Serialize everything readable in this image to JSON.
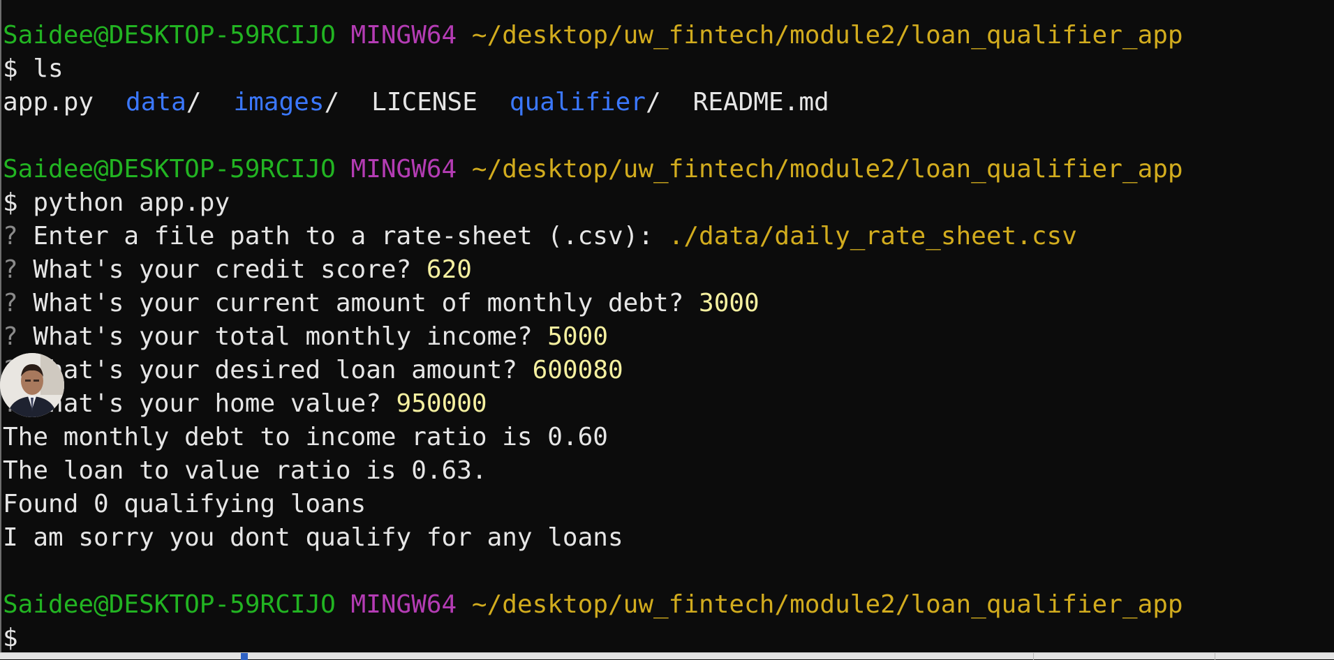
{
  "prompt": {
    "user_host": "Saidee@DESKTOP-59RCIJO",
    "env": "MINGW64",
    "path": "~/desktop/uw_fintech/module2/loan_qualifier_app",
    "symbol": "$"
  },
  "commands": {
    "ls": "ls",
    "run": "python app.py"
  },
  "listing": [
    {
      "name": "app.py",
      "is_dir": false
    },
    {
      "name": "data",
      "is_dir": true
    },
    {
      "name": "images",
      "is_dir": true
    },
    {
      "name": "LICENSE",
      "is_dir": false
    },
    {
      "name": "qualifier",
      "is_dir": true
    },
    {
      "name": "README.md",
      "is_dir": false
    }
  ],
  "dir_suffix": "/",
  "question_mark": "?",
  "questions": [
    {
      "text": "Enter a file path to a rate-sheet (.csv): ",
      "answer": "./data/daily_rate_sheet.csv"
    },
    {
      "text": "What's your credit score? ",
      "answer": "620"
    },
    {
      "text": "What's your current amount of monthly debt? ",
      "answer": "3000"
    },
    {
      "text": "What's your total monthly income? ",
      "answer": "5000"
    },
    {
      "text": "What's your desired loan amount? ",
      "answer": "600080"
    },
    {
      "text": "What's your home value? ",
      "answer": "950000"
    }
  ],
  "output": [
    "The monthly debt to income ratio is 0.60",
    "The loan to value ratio is 0.63.",
    "Found 0 qualifying loans",
    "I am sorry you dont qualify for any loans"
  ],
  "colors": {
    "background": "#0c0c0c",
    "user_host": "#22b422",
    "env": "#b43cb4",
    "path": "#d2ac1e",
    "directory": "#3b78ff",
    "answer": "#f5f0a0",
    "text": "#e6e6e6"
  },
  "overlay": {
    "icon": "webcam-avatar-icon"
  }
}
